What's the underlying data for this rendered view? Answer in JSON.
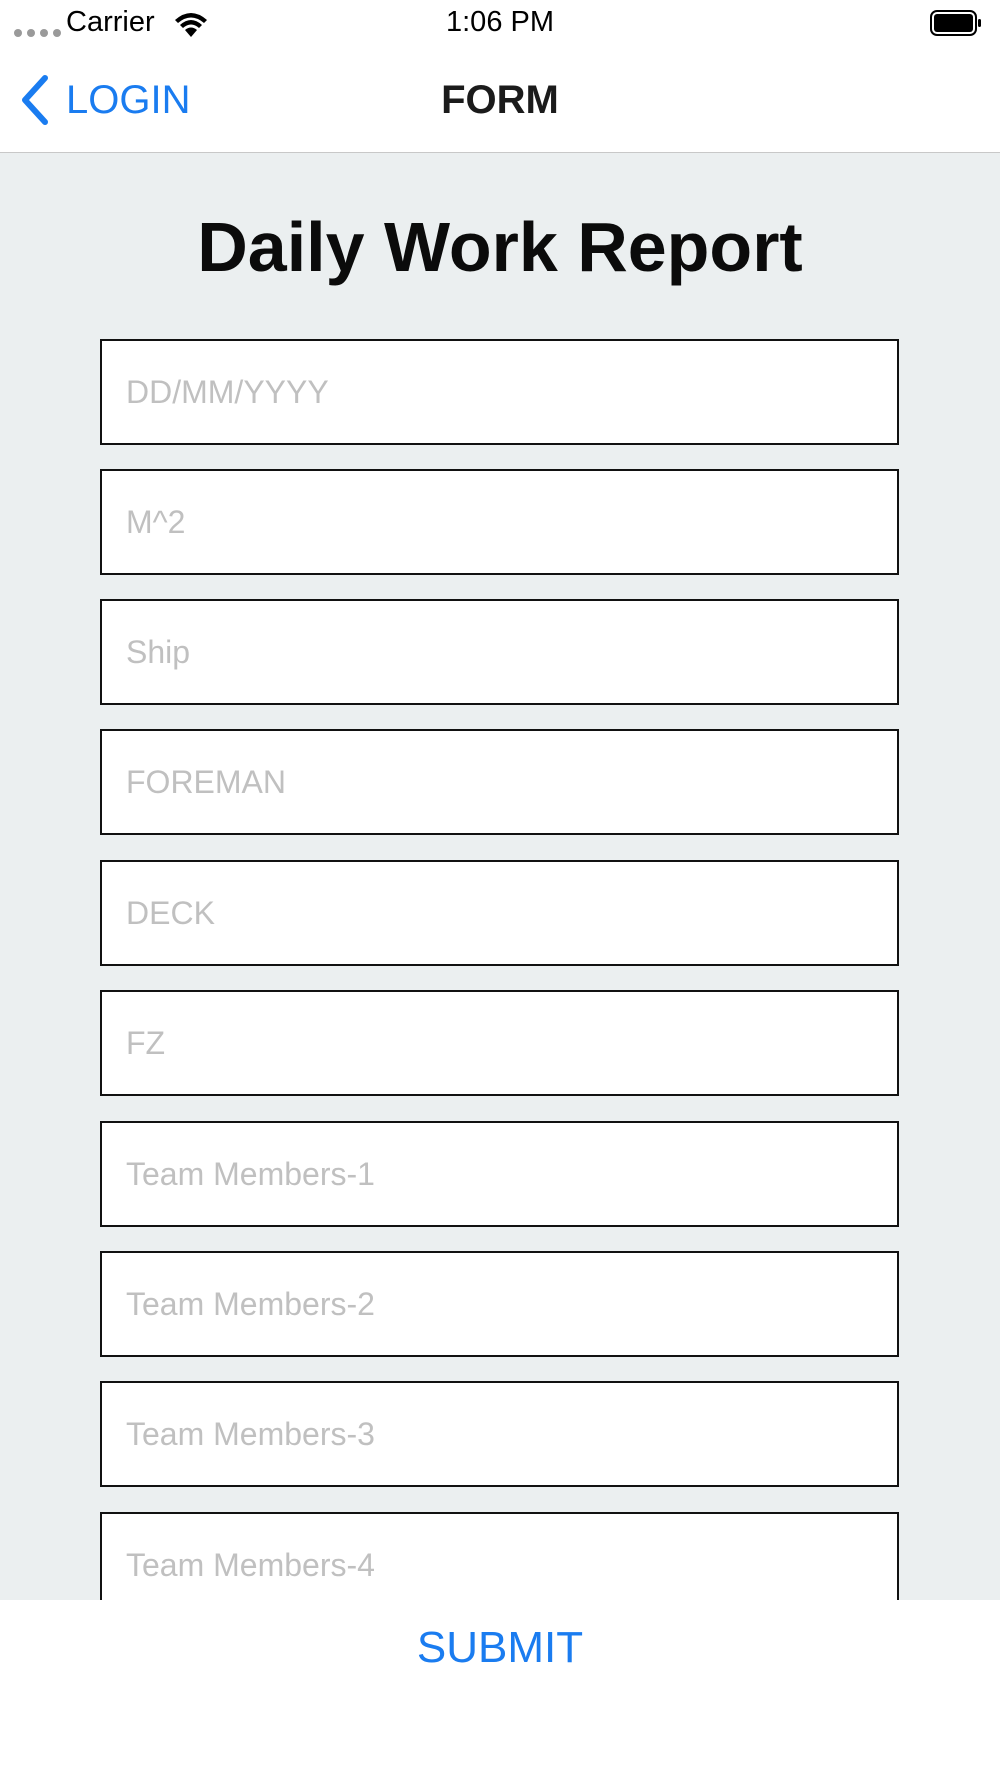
{
  "status_bar": {
    "carrier": "Carrier",
    "time": "1:06 PM",
    "icons": [
      "signal-dots-icon",
      "wifi-icon",
      "battery-icon"
    ]
  },
  "nav_bar": {
    "back_label": "LOGIN",
    "back_icon": "chevron-left-icon",
    "title": "FORM"
  },
  "form": {
    "title": "Daily Work Report",
    "fields": [
      {
        "placeholder": "DD/MM/YYYY",
        "value": ""
      },
      {
        "placeholder": "M^2",
        "value": ""
      },
      {
        "placeholder": "Ship",
        "value": ""
      },
      {
        "placeholder": "FOREMAN",
        "value": ""
      },
      {
        "placeholder": "DECK",
        "value": ""
      },
      {
        "placeholder": "FZ",
        "value": ""
      },
      {
        "placeholder": "Team Members-1",
        "value": ""
      },
      {
        "placeholder": "Team Members-2",
        "value": ""
      },
      {
        "placeholder": "Team Members-3",
        "value": ""
      },
      {
        "placeholder": "Team Members-4",
        "value": ""
      }
    ],
    "submit_label": "SUBMIT"
  },
  "colors": {
    "accent": "#1a7cf0",
    "content_background": "#ebeff0",
    "placeholder": "#c0c0c0",
    "field_border": "#111111"
  }
}
